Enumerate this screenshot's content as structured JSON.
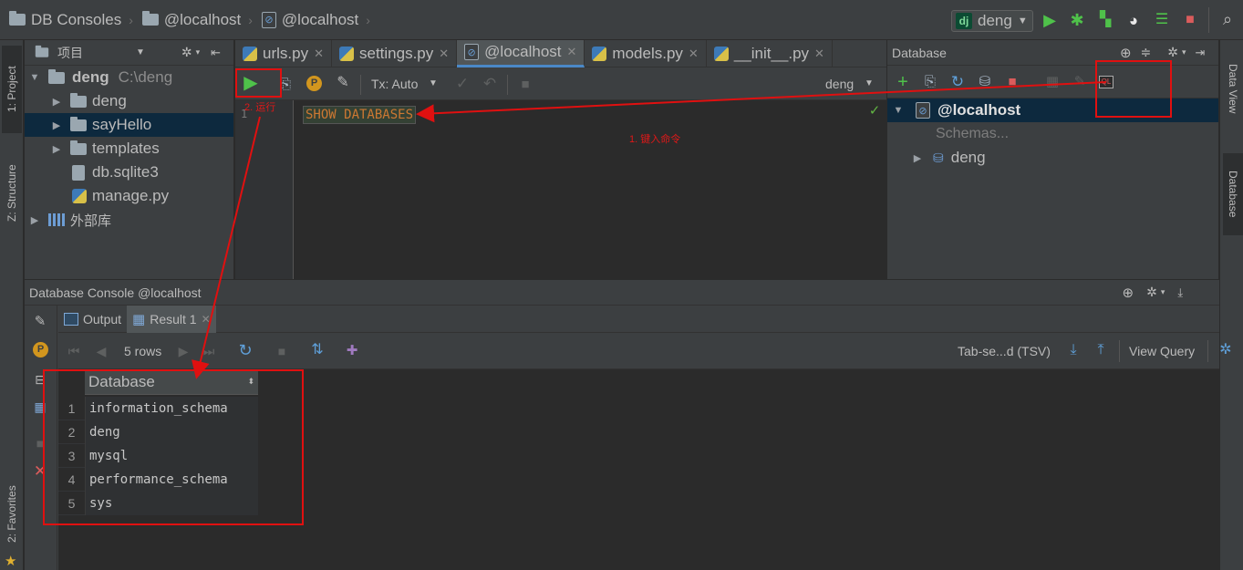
{
  "navbar": {
    "crumbs": [
      "DB Consoles",
      "@localhost",
      "@localhost"
    ],
    "run_config": "deng"
  },
  "left_strip": {
    "tabs": [
      "1: Project",
      "Z: Structure",
      "2: Favorites"
    ]
  },
  "right_strip": {
    "tabs": [
      "Data View",
      "Database"
    ]
  },
  "project": {
    "header": "项目",
    "tree": [
      {
        "label": "deng",
        "path": "C:\\deng"
      },
      {
        "label": "deng"
      },
      {
        "label": "sayHello"
      },
      {
        "label": "templates"
      },
      {
        "label": "db.sqlite3"
      },
      {
        "label": "manage.py"
      },
      {
        "label": "外部库"
      }
    ]
  },
  "editor": {
    "tabs": [
      "urls.py",
      "settings.py",
      "@localhost",
      "models.py",
      "__init__.py"
    ],
    "tx_mode": "Tx: Auto",
    "schema": "deng",
    "line_number": "1",
    "code": "SHOW DATABASES"
  },
  "annotations": {
    "run": "2. 运行",
    "type_command": "1. 键入命令"
  },
  "database": {
    "header": "Database",
    "tree": [
      {
        "label": "@localhost"
      },
      {
        "label": "Schemas..."
      },
      {
        "label": "deng"
      }
    ]
  },
  "console": {
    "header": "Database Console @localhost",
    "tabs": [
      "Output",
      "Result 1"
    ],
    "rows_label": "5 rows",
    "export_format": "Tab-se...d (TSV)",
    "view_query": "View Query",
    "column": "Database",
    "rows": [
      {
        "n": "1",
        "value": "information_schema"
      },
      {
        "n": "2",
        "value": "deng"
      },
      {
        "n": "3",
        "value": "mysql"
      },
      {
        "n": "4",
        "value": "performance_schema"
      },
      {
        "n": "5",
        "value": "sys"
      }
    ]
  }
}
